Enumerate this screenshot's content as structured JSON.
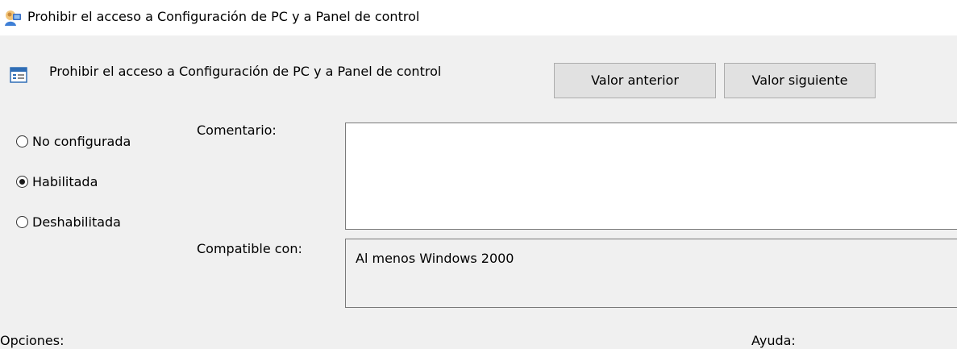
{
  "window": {
    "title": "Prohibir el acceso a Configuración de PC y a Panel de control",
    "icon": "group-policy-editor-icon"
  },
  "policy": {
    "name": "Prohibir el acceso a Configuración de PC y a Panel de control",
    "icon": "policy-setting-icon"
  },
  "buttons": {
    "previous_label": "Valor anterior",
    "next_label": "Valor siguiente"
  },
  "state": {
    "options": [
      {
        "label": "No configurada",
        "checked": false
      },
      {
        "label": "Habilitada",
        "checked": true
      },
      {
        "label": "Deshabilitada",
        "checked": false
      }
    ]
  },
  "comment": {
    "label": "Comentario:",
    "value": ""
  },
  "compatibility": {
    "label": "Compatible con:",
    "value": "Al menos Windows 2000"
  },
  "sections": {
    "options_label": "Opciones:",
    "help_label": "Ayuda:"
  },
  "colors": {
    "panel_background": "#f0f0f0",
    "button_background": "#e1e1e1",
    "button_border": "#adadad"
  }
}
